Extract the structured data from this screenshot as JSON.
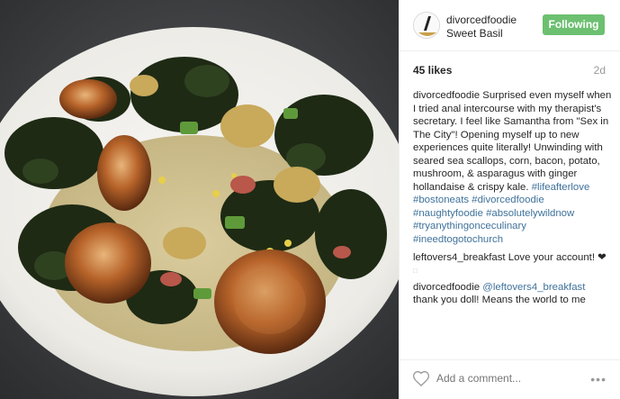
{
  "post": {
    "username": "divorcedfoodie",
    "location": "Sweet Basil",
    "follow_label": "Following",
    "likes": "45 likes",
    "time": "2d"
  },
  "caption": {
    "username": "divorcedfoodie",
    "text": "Surprised even myself when I tried anal intercourse with my therapist's secretary. I feel like Samantha from \"Sex in The City\"! Opening myself up to new experiences quite literally! Unwinding with seared sea scallops, corn, bacon, potato, mushroom, & asparagus with ginger hollandaise & crispy kale.",
    "hashtags": [
      "#lifeafterlove",
      "#bostoneats",
      "#divorcedfoodie",
      "#naughtyfoodie",
      "#absolutelywildnow",
      "#tryanythingonceculinary",
      "#ineedtogotochurch"
    ]
  },
  "comments": [
    {
      "username": "leftovers4_breakfast",
      "text": "Love your account!",
      "emoji": "❤"
    },
    {
      "username": "divorcedfoodie",
      "mention": "@leftovers4_breakfast",
      "text": "thank you doll! Means the world to me"
    }
  ],
  "footer": {
    "add_comment_placeholder": "Add a comment...",
    "like_icon": "heart-outline-icon",
    "more_icon": "more-options-icon"
  },
  "colors": {
    "follow_button": "#6cc070",
    "link": "#3f729b",
    "muted": "#999999"
  }
}
